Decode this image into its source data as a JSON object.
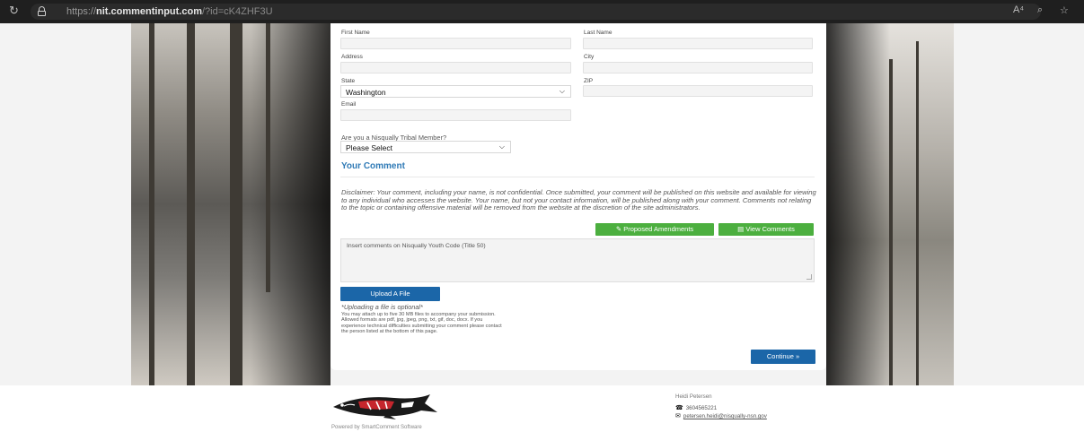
{
  "browser": {
    "url_prefix": "https://",
    "url_host": "nit.commentinput.com",
    "url_rest": "/?id=cK4ZHF3U",
    "icons": [
      "reload-icon",
      "lock-icon",
      "read-aloud-icon",
      "zoom-icon",
      "favorites-icon"
    ]
  },
  "form": {
    "first_name_label": "First Name",
    "last_name_label": "Last Name",
    "address_label": "Address",
    "city_label": "City",
    "state_label": "State",
    "state_value": "Washington",
    "zip_label": "ZIP",
    "email_label": "Email",
    "member_question": "Are you a Nisqually Tribal Member?",
    "member_value": "Please Select",
    "your_comment": "Your Comment",
    "disclaimer": "Disclaimer: Your comment, including your name, is not confidential. Once submitted, your comment will be published on this website and available for viewing to any individual who accesses the website. Your name, but not your contact information, will be published along with your comment. Comments not relating to the topic or containing offensive material will be removed from the website at the discretion of the site administrators.",
    "proposed_amendments": "Proposed Amendments",
    "view_comments": "View Comments",
    "comment_placeholder": "Insert comments on Nisqually Youth Code (Title 50)",
    "upload_button": "Upload A File",
    "upload_optional": "*Uploading a file is optional*",
    "upload_note": "You may attach up to five 30 MB files to accompany your submission. Allowed formats are pdf, jpg, jpeg, png, txt, gif, doc, docx. If you experience technical difficulties submitting your comment please contact the person listed at the bottom of this page.",
    "continue_button": "Continue »"
  },
  "footer": {
    "powered_by": "Powered by SmartComment Software",
    "contact_name": "Heidi Petersen",
    "contact_phone": "3604565221",
    "contact_email": "petersen.heidi@nisqually-nsn.gov"
  },
  "colors": {
    "accent_blue": "#1b66a8",
    "section_blue": "#2f7ab6",
    "button_green": "#4caf3f"
  }
}
